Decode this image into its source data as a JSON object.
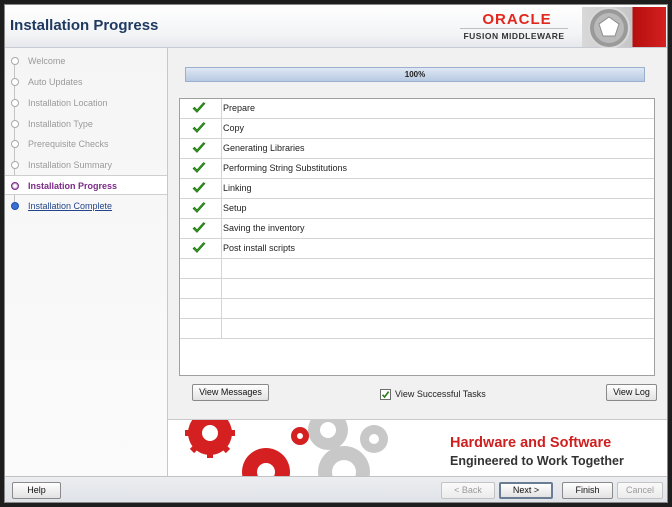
{
  "window": {
    "title": "Installation Progress",
    "brand": "ORACLE",
    "product": "FUSION MIDDLEWARE"
  },
  "sidebar": {
    "steps": [
      {
        "label": "Welcome",
        "state": "done"
      },
      {
        "label": "Auto Updates",
        "state": "done"
      },
      {
        "label": "Installation Location",
        "state": "done"
      },
      {
        "label": "Installation Type",
        "state": "done"
      },
      {
        "label": "Prerequisite Checks",
        "state": "done"
      },
      {
        "label": "Installation Summary",
        "state": "done"
      },
      {
        "label": "Installation Progress",
        "state": "current"
      },
      {
        "label": "Installation Complete",
        "state": "next"
      }
    ]
  },
  "progress": {
    "value": 1.0,
    "text": "100%"
  },
  "tasks": {
    "rows": [
      {
        "name": "Prepare",
        "status": "done"
      },
      {
        "name": "Copy",
        "status": "done"
      },
      {
        "name": "Generating Libraries",
        "status": "done"
      },
      {
        "name": "Performing String Substitutions",
        "status": "done"
      },
      {
        "name": "Linking",
        "status": "done"
      },
      {
        "name": "Setup",
        "status": "done"
      },
      {
        "name": "Saving the inventory",
        "status": "done"
      },
      {
        "name": "Post install scripts",
        "status": "done"
      }
    ],
    "empty_rows": 4
  },
  "actions": {
    "view_messages": "View Messages",
    "view_successful": "View Successful Tasks",
    "view_successful_checked": true,
    "view_log": "View Log"
  },
  "banner": {
    "line1": "Hardware and Software",
    "line2": "Engineered to Work Together"
  },
  "footer": {
    "help": "Help",
    "back": "< Back",
    "next": "Next >",
    "finish": "Finish",
    "cancel": "Cancel"
  },
  "colors": {
    "brand_red": "#e3271d",
    "title_blue": "#1f3a60",
    "current_step": "#7b2a86",
    "check_green": "#2e9a1c"
  },
  "icons": {
    "task_status": "check-icon",
    "emblem": "oracle-emblem-icon"
  }
}
